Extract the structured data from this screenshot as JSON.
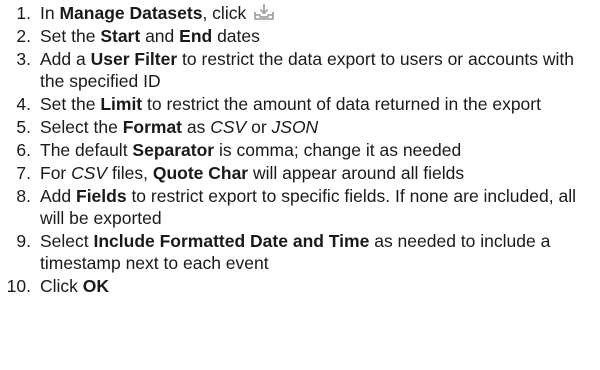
{
  "steps": [
    {
      "number": "1.",
      "parts": [
        {
          "t": "In "
        },
        {
          "t": "Manage Datasets",
          "b": true
        },
        {
          "t": ", click "
        },
        {
          "icon": "export-download-icon"
        }
      ]
    },
    {
      "number": "2.",
      "parts": [
        {
          "t": "Set the "
        },
        {
          "t": "Start",
          "b": true
        },
        {
          "t": " and "
        },
        {
          "t": "End",
          "b": true
        },
        {
          "t": " dates"
        }
      ]
    },
    {
      "number": "3.",
      "parts": [
        {
          "t": "Add a "
        },
        {
          "t": "User Filter",
          "b": true
        },
        {
          "t": " to restrict the data export to users or accounts with the specified ID"
        }
      ]
    },
    {
      "number": "4.",
      "parts": [
        {
          "t": "Set the "
        },
        {
          "t": "Limit",
          "b": true
        },
        {
          "t": " to restrict the amount of data returned in the export"
        }
      ]
    },
    {
      "number": "5.",
      "parts": [
        {
          "t": "Select the "
        },
        {
          "t": "Format",
          "b": true
        },
        {
          "t": " as "
        },
        {
          "t": "CSV",
          "i": true
        },
        {
          "t": " or "
        },
        {
          "t": "JSON",
          "i": true
        }
      ]
    },
    {
      "number": "6.",
      "parts": [
        {
          "t": "The default "
        },
        {
          "t": "Separator",
          "b": true
        },
        {
          "t": " is comma; change it as needed"
        }
      ]
    },
    {
      "number": "7.",
      "parts": [
        {
          "t": "For "
        },
        {
          "t": "CSV",
          "i": true
        },
        {
          "t": " files, "
        },
        {
          "t": "Quote Char",
          "b": true
        },
        {
          "t": " will appear around all fields"
        }
      ]
    },
    {
      "number": "8.",
      "parts": [
        {
          "t": "Add "
        },
        {
          "t": "Fields",
          "b": true
        },
        {
          "t": " to restrict export to specific fields. If none are included, all will be exported"
        }
      ]
    },
    {
      "number": "9.",
      "parts": [
        {
          "t": "Select "
        },
        {
          "t": "Include Formatted Date and Time",
          "b": true
        },
        {
          "t": " as needed to include a timestamp next to each event"
        }
      ]
    },
    {
      "number": "10.",
      "parts": [
        {
          "t": "Click "
        },
        {
          "t": "OK",
          "b": true
        }
      ]
    }
  ]
}
